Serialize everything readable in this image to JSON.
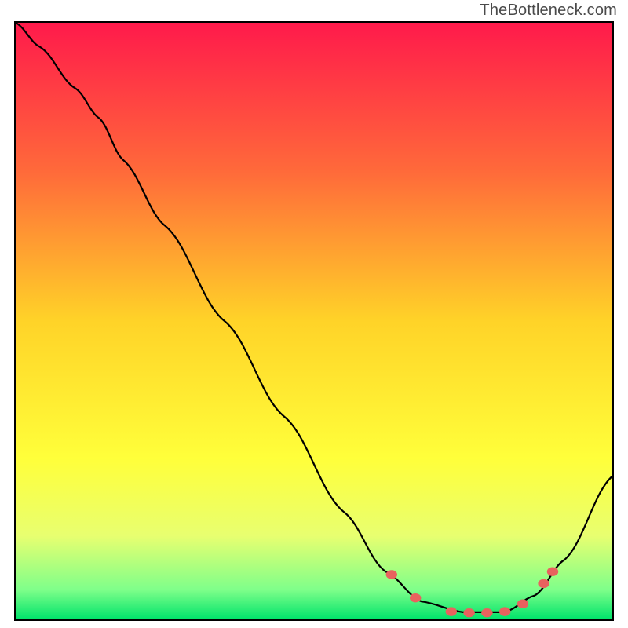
{
  "watermark": "TheBottleneck.com",
  "chart_data": {
    "type": "line",
    "title": "",
    "xlabel": "",
    "ylabel": "",
    "x_range": [
      0,
      100
    ],
    "y_range": [
      0,
      100
    ],
    "legend": false,
    "grid": false,
    "annotations": [],
    "background": {
      "type": "vertical-gradient",
      "stops": [
        {
          "offset": 0.0,
          "color": "#ff1a4b"
        },
        {
          "offset": 0.25,
          "color": "#ff6a3a"
        },
        {
          "offset": 0.5,
          "color": "#ffd328"
        },
        {
          "offset": 0.73,
          "color": "#ffff3a"
        },
        {
          "offset": 0.86,
          "color": "#e8ff70"
        },
        {
          "offset": 0.95,
          "color": "#7fff8a"
        },
        {
          "offset": 1.0,
          "color": "#00e36b"
        }
      ]
    },
    "series": [
      {
        "name": "curve",
        "color": "#000000",
        "points": [
          {
            "x": 0.0,
            "y": 100.0
          },
          {
            "x": 4.0,
            "y": 96.0
          },
          {
            "x": 10.0,
            "y": 89.0
          },
          {
            "x": 14.0,
            "y": 84.0
          },
          {
            "x": 18.0,
            "y": 77.0
          },
          {
            "x": 25.0,
            "y": 66.0
          },
          {
            "x": 35.0,
            "y": 50.0
          },
          {
            "x": 45.0,
            "y": 34.0
          },
          {
            "x": 55.0,
            "y": 18.0
          },
          {
            "x": 62.0,
            "y": 8.0
          },
          {
            "x": 68.0,
            "y": 3.0
          },
          {
            "x": 75.0,
            "y": 1.2
          },
          {
            "x": 82.0,
            "y": 1.2
          },
          {
            "x": 87.0,
            "y": 4.0
          },
          {
            "x": 92.0,
            "y": 10.0
          },
          {
            "x": 100.0,
            "y": 24.0
          }
        ]
      }
    ],
    "markers": {
      "name": "highlighted-points",
      "color": "#e8625e",
      "points": [
        {
          "x": 63.0,
          "y": 7.5
        },
        {
          "x": 67.0,
          "y": 3.6
        },
        {
          "x": 73.0,
          "y": 1.3
        },
        {
          "x": 76.0,
          "y": 1.1
        },
        {
          "x": 79.0,
          "y": 1.1
        },
        {
          "x": 82.0,
          "y": 1.3
        },
        {
          "x": 85.0,
          "y": 2.6
        },
        {
          "x": 88.5,
          "y": 6.0
        },
        {
          "x": 90.0,
          "y": 8.0
        }
      ]
    }
  }
}
